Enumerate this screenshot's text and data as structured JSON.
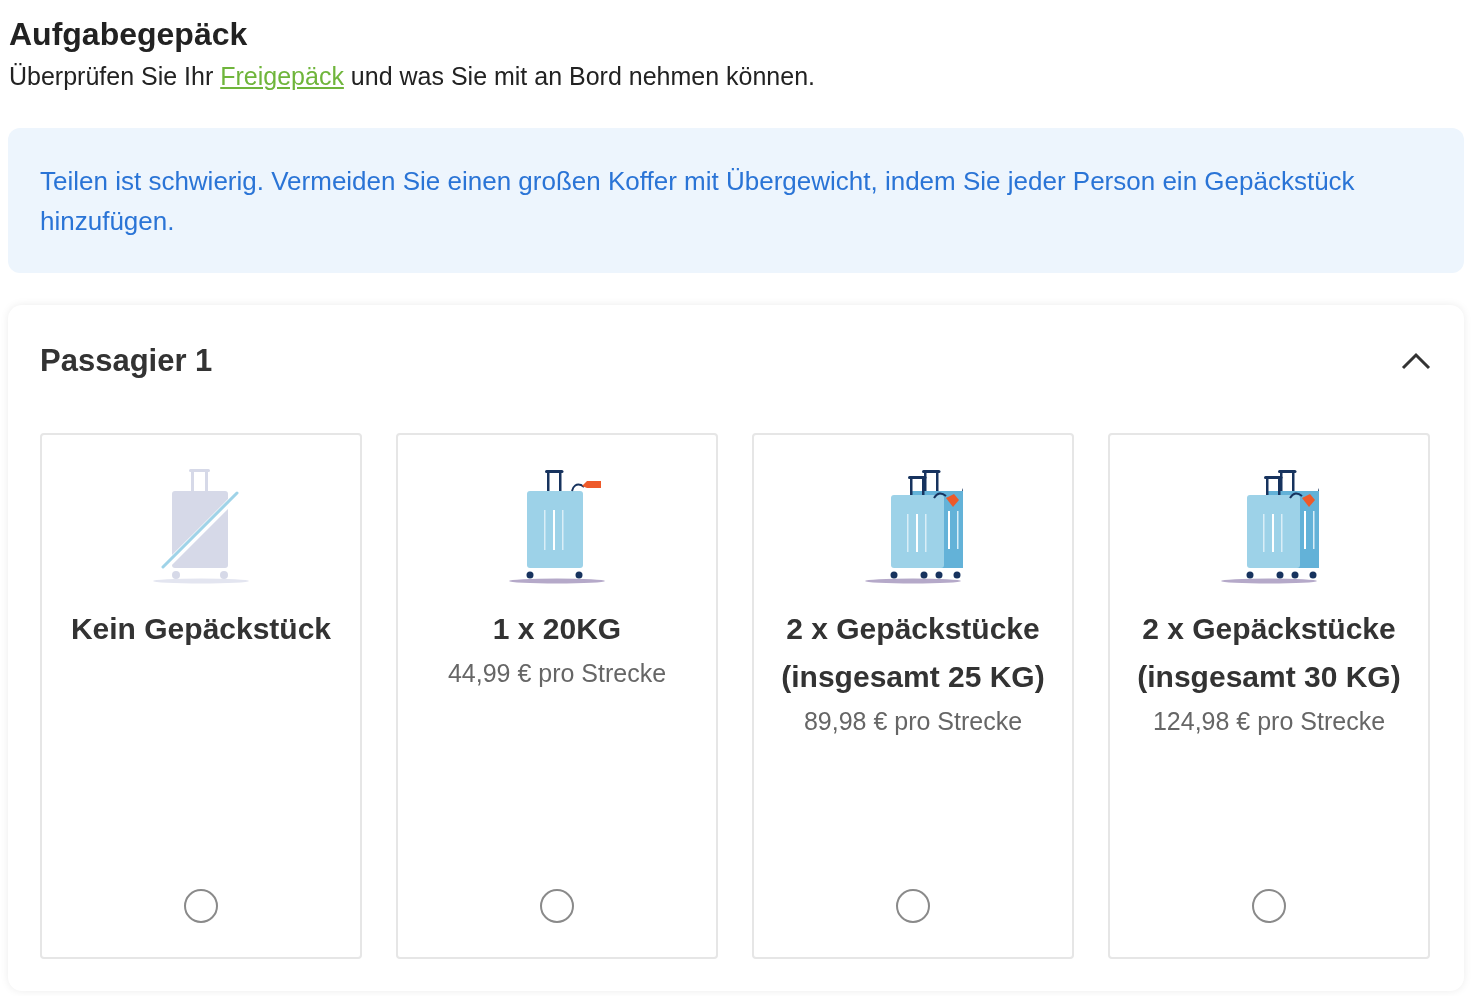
{
  "heading": "Aufgabegepäck",
  "intro": {
    "before": "Überprüfen Sie Ihr ",
    "link": "Freigepäck",
    "after": " und was Sie mit an Bord nehmen können."
  },
  "notice": "Teilen ist schwierig. Vermeiden Sie einen großen Koffer mit Übergewicht, indem Sie jeder Person ein Gepäckstück hinzufügen.",
  "passenger": {
    "title": "Passagier 1",
    "expanded": true,
    "options": [
      {
        "kind": "none",
        "title": "Kein Gepäckstück",
        "selected": false
      },
      {
        "kind": "single",
        "title": "1 x 20KG",
        "price": "44,99 € pro Strecke",
        "selected": false
      },
      {
        "kind": "double",
        "title": "2 x Gepäckstücke (insgesamt 25 KG)",
        "price": "89,98 € pro Strecke",
        "selected": false
      },
      {
        "kind": "double",
        "title": "2 x Gepäckstücke (insgesamt 30 KG)",
        "price": "124,98 € pro Strecke",
        "selected": false
      }
    ]
  }
}
